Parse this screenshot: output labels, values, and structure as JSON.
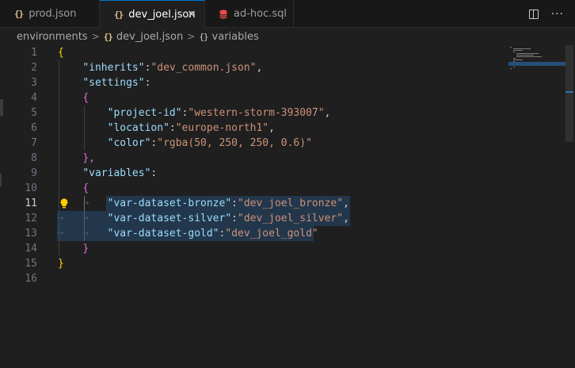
{
  "tabs": [
    {
      "label": "prod.json",
      "icon": "json-braces-icon",
      "icon_glyph": "{}",
      "active": false
    },
    {
      "label": "dev_joel.json",
      "icon": "json-braces-icon",
      "icon_glyph": "{}",
      "active": true,
      "close": "×"
    },
    {
      "label": "ad-hoc.sql",
      "icon": "database-icon",
      "active": false
    }
  ],
  "toolbar": {
    "more": "···"
  },
  "breadcrumb": {
    "folder": "environments",
    "separator": ">",
    "file_icon": "{}",
    "file": "dev_joel.json",
    "symbol_icon": "{}",
    "symbol": "variables"
  },
  "editor": {
    "current_line": 11,
    "lines": [
      {
        "n": "1"
      },
      {
        "n": "2"
      },
      {
        "n": "3"
      },
      {
        "n": "4"
      },
      {
        "n": "5"
      },
      {
        "n": "6"
      },
      {
        "n": "7"
      },
      {
        "n": "8"
      },
      {
        "n": "9"
      },
      {
        "n": "10"
      },
      {
        "n": "11"
      },
      {
        "n": "12"
      },
      {
        "n": "13"
      },
      {
        "n": "14"
      },
      {
        "n": "15"
      },
      {
        "n": "16"
      }
    ],
    "tokens": {
      "brace_open": "{",
      "brace_close": "}",
      "brace_close_comma": "},",
      "inherits_key": "\"inherits\"",
      "inherits_val": "\"dev_common.json\"",
      "settings_key": "\"settings\"",
      "project_key": "\"project-id\"",
      "project_val": "\"western-storm-393007\"",
      "location_key": "\"location\"",
      "location_val": "\"europe-north1\"",
      "color_key": "\"color\"",
      "color_val": "\"rgba(50, 250, 250, 0.6)\"",
      "variables_key": "\"variables\"",
      "bronze_key": "\"var-dataset-bronze\"",
      "bronze_val": "\"dev_joel_bronze\"",
      "silver_key": "\"var-dataset-silver\"",
      "silver_val": "\"dev_joel_silver\"",
      "gold_key": "\"var-dataset-gold\"",
      "gold_val": "\"dev_joel_gold\"",
      "colon": ":",
      "comma": ",",
      "tab_arrow": "→"
    }
  },
  "colors": {
    "background": "#1f1f1f",
    "accent": "#0078d4",
    "json_key": "#9cdcfe",
    "json_string": "#ce9178",
    "bracket_level1": "#ffd700",
    "bracket_level2": "#da70d6",
    "bracket_level3": "#179fff",
    "selection": "#264f78"
  }
}
